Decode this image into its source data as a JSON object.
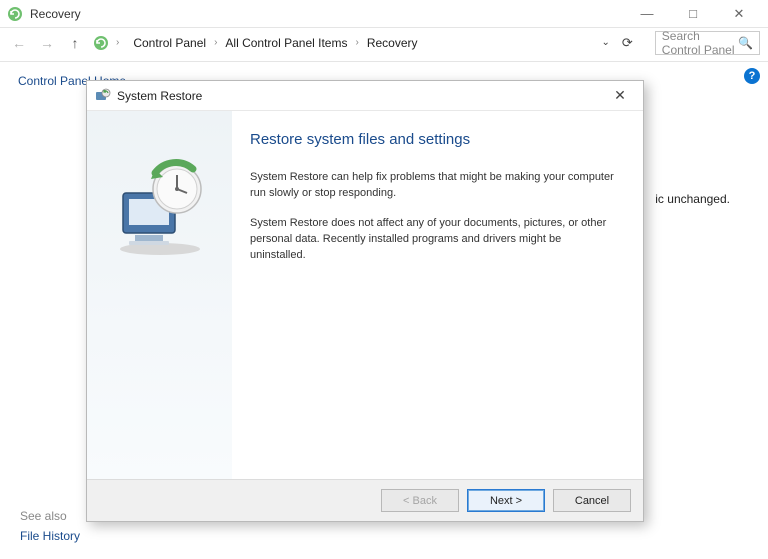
{
  "window": {
    "title": "Recovery",
    "minimize": "—",
    "maximize": "□",
    "close": "✕"
  },
  "nav": {
    "crumb1": "Control Panel",
    "crumb2": "All Control Panel Items",
    "crumb3": "Recovery",
    "search_placeholder": "Search Control Panel"
  },
  "page": {
    "cp_home": "Control Panel Home",
    "bg_snippet": "ic unchanged.",
    "see_also": "See also",
    "file_history": "File History"
  },
  "dialog": {
    "title": "System Restore",
    "heading": "Restore system files and settings",
    "p1": "System Restore can help fix problems that might be making your computer run slowly or stop responding.",
    "p2": "System Restore does not affect any of your documents, pictures, or other personal data. Recently installed programs and drivers might be uninstalled.",
    "btn_back": "< Back",
    "btn_next": "Next >",
    "btn_cancel": "Cancel"
  }
}
